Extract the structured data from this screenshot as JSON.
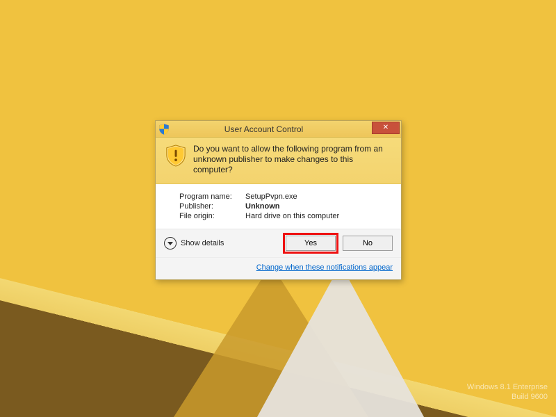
{
  "desktop": {
    "watermark_line1": "Windows 8.1 Enterprise",
    "watermark_line2": "Build 9600"
  },
  "dialog": {
    "title": "User Account Control",
    "close_aria": "Close",
    "banner_message": "Do you want to allow the following program from an unknown publisher to make changes to this computer?",
    "labels": {
      "program_name": "Program name:",
      "publisher": "Publisher:",
      "file_origin": "File origin:"
    },
    "values": {
      "program_name": "SetupPvpn.exe",
      "publisher": "Unknown",
      "file_origin": "Hard drive on this computer"
    },
    "show_details": "Show details",
    "yes": "Yes",
    "no": "No",
    "change_link": "Change when these notifications appear"
  }
}
